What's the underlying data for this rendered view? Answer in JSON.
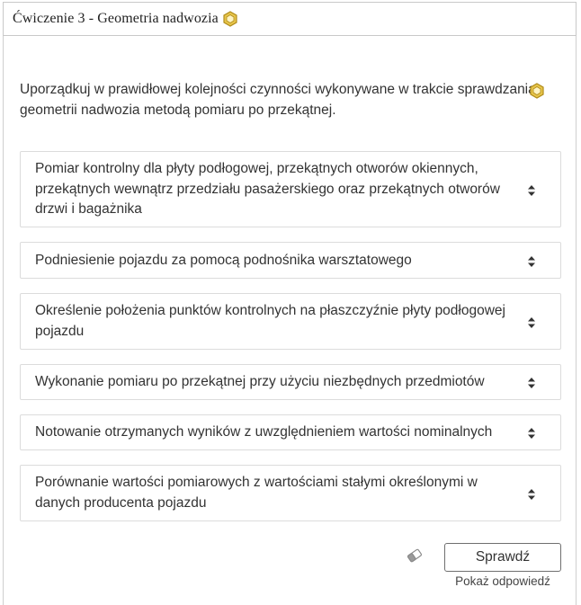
{
  "header": {
    "title": "Ćwiczenie 3 - Geometria nadwozia",
    "badge_icon": "hexagon-badge-icon",
    "badge_color": "#c9a227"
  },
  "question": {
    "instruction": "Uporządkuj w prawidłowej kolejności czynności wykonywane w trakcie sprawdzania geometrii nadwozia metodą pomiaru po przekątnej.",
    "badge_icon": "hexagon-badge-icon"
  },
  "items": [
    {
      "label": "Pomiar kontrolny dla płyty podłogowej, przekątnych otworów okiennych, przekątnych wewnątrz przedziału pasażerskiego oraz przekątnych otworów drzwi i bagażnika"
    },
    {
      "label": "Podniesienie pojazdu za pomocą podnośnika warsztatowego"
    },
    {
      "label": "Określenie położenia punktów kontrolnych na płaszczyźnie płyty podłogowej pojazdu"
    },
    {
      "label": "Wykonanie pomiaru po przekątnej przy użyciu niezbędnych przedmiotów"
    },
    {
      "label": "Notowanie otrzymanych wyników z uwzględnieniem wartości nominalnych"
    },
    {
      "label": "Porównanie wartości pomiarowych z wartościami stałymi określonymi w danych producenta pojazdu"
    }
  ],
  "item_icon": "sort-arrows-icon",
  "footer": {
    "reset_icon": "eraser-icon",
    "check_label": "Sprawdź",
    "show_answer_label": "Pokaż odpowiedź"
  }
}
